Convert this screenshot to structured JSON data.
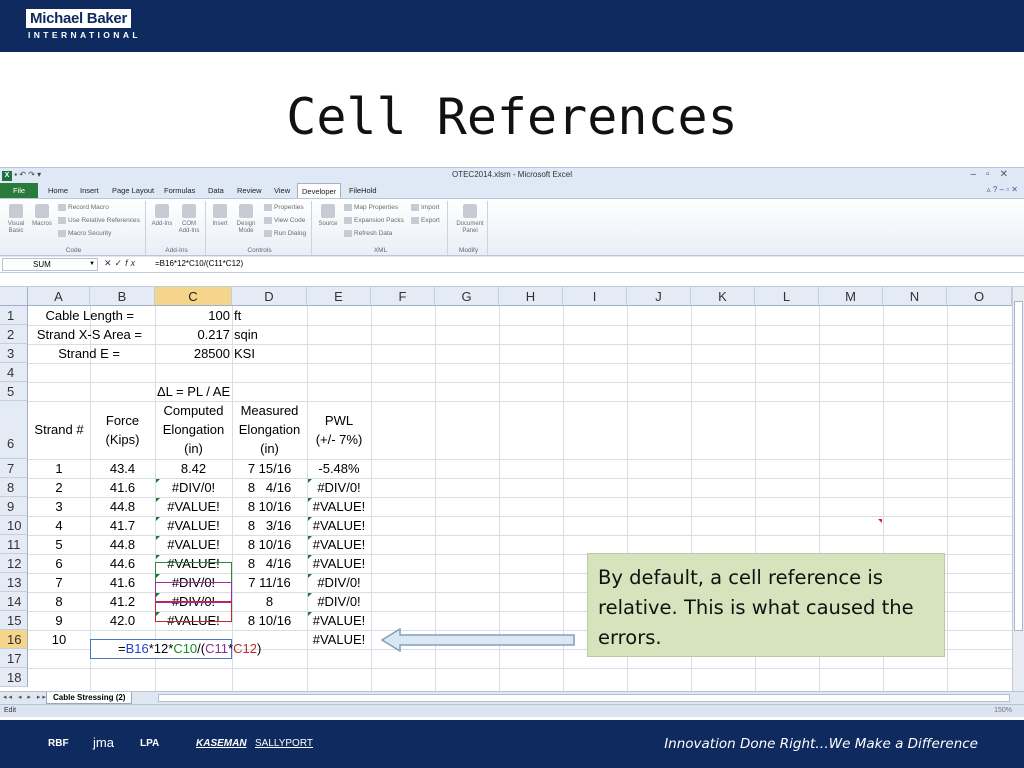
{
  "header": {
    "logo_name": "Michael Baker",
    "logo_sub": "INTERNATIONAL"
  },
  "slide": {
    "title": "Cell References"
  },
  "excel": {
    "window_title": "OTEC2014.xlsm - Microsoft Excel",
    "tabs": [
      "File",
      "Home",
      "Insert",
      "Page Layout",
      "Formulas",
      "Data",
      "Review",
      "View",
      "Developer",
      "FileHold"
    ],
    "active_tab": "Developer",
    "ribbon": {
      "code": {
        "label": "Code",
        "visual_basic": "Visual Basic",
        "macros": "Macros",
        "record_macro": "Record Macro",
        "use_relative": "Use Relative References",
        "macro_security": "Macro Security"
      },
      "addins": {
        "label": "Add-Ins",
        "addins": "Add-Ins",
        "com_addins": "COM Add-Ins"
      },
      "controls": {
        "label": "Controls",
        "insert": "Insert",
        "design_mode": "Design Mode",
        "properties": "Properties",
        "view_code": "View Code",
        "run_dialog": "Run Dialog"
      },
      "xml": {
        "label": "XML",
        "source": "Source",
        "map_properties": "Map Properties",
        "expansion_packs": "Expansion Packs",
        "refresh_data": "Refresh Data",
        "import": "Import",
        "export": "Export"
      },
      "modify": {
        "label": "Modify",
        "document_panel": "Document Panel"
      }
    },
    "name_box": "SUM",
    "fx": "fx",
    "formula": "=B16*12*C10/(C11*C12)",
    "columns": [
      "A",
      "B",
      "C",
      "D",
      "E",
      "F",
      "G",
      "H",
      "I",
      "J",
      "K",
      "L",
      "M",
      "N",
      "O"
    ],
    "rows": [
      "1",
      "2",
      "3",
      "4",
      "5",
      "6",
      "7",
      "8",
      "9",
      "10",
      "11",
      "12",
      "13",
      "14",
      "15",
      "16",
      "17",
      "18"
    ],
    "params": [
      {
        "label": "Cable Length =",
        "value": "100",
        "unit": "ft"
      },
      {
        "label": "Strand X-S Area =",
        "value": "0.217",
        "unit": "sqin"
      },
      {
        "label": "Strand E =",
        "value": "28500",
        "unit": "KSI"
      }
    ],
    "eq_label": "ΔL = PL / AE",
    "headers": {
      "strand": "Strand #",
      "force_1": "Force",
      "force_2": "(Kips)",
      "comp_1": "Computed",
      "comp_2": "Elongation",
      "comp_3": "(in)",
      "meas_1": "Measured",
      "meas_2": "Elongation",
      "meas_3": "(in)",
      "pwl_1": "PWL",
      "pwl_2": "(+/- 7%)"
    },
    "data_rows": [
      {
        "strand": "1",
        "force": "43.4",
        "computed": "8.42",
        "measured": "7 15/16",
        "pwl": "-5.48%"
      },
      {
        "strand": "2",
        "force": "41.6",
        "computed": "#DIV/0!",
        "measured": "8   4/16",
        "pwl": "#DIV/0!"
      },
      {
        "strand": "3",
        "force": "44.8",
        "computed": "#VALUE!",
        "measured": "8 10/16",
        "pwl": "#VALUE!"
      },
      {
        "strand": "4",
        "force": "41.7",
        "computed": "#VALUE!",
        "measured": "8   3/16",
        "pwl": "#VALUE!"
      },
      {
        "strand": "5",
        "force": "44.8",
        "computed": "#VALUE!",
        "measured": "8 10/16",
        "pwl": "#VALUE!"
      },
      {
        "strand": "6",
        "force": "44.6",
        "computed": "#VALUE!",
        "measured": "8   4/16",
        "pwl": "#VALUE!"
      },
      {
        "strand": "7",
        "force": "41.6",
        "computed": "#DIV/0!",
        "measured": "7 11/16",
        "pwl": "#DIV/0!"
      },
      {
        "strand": "8",
        "force": "41.2",
        "computed": "#DIV/0!",
        "measured": "8",
        "pwl": "#DIV/0!"
      },
      {
        "strand": "9",
        "force": "42.0",
        "computed": "#VALUE!",
        "measured": "8 10/16",
        "pwl": "#VALUE!"
      }
    ],
    "edit_row": {
      "strand": "10",
      "formula_parts": [
        "=",
        "B16",
        "*12*",
        "C10",
        "/(",
        "C11",
        "*",
        "C12",
        ")"
      ],
      "pwl": "#VALUE!"
    },
    "sheet_tab": "Cable Stressing (2)",
    "status": "Edit",
    "zoom": "150%"
  },
  "callout": {
    "text": "By default, a cell reference is relative. This is what caused the errors."
  },
  "footer": {
    "partners": [
      "RBF",
      "jma",
      "LPA",
      "KASEMAN",
      "SALLYPORT"
    ],
    "tagline": "Innovation Done Right…We Make a Difference"
  }
}
